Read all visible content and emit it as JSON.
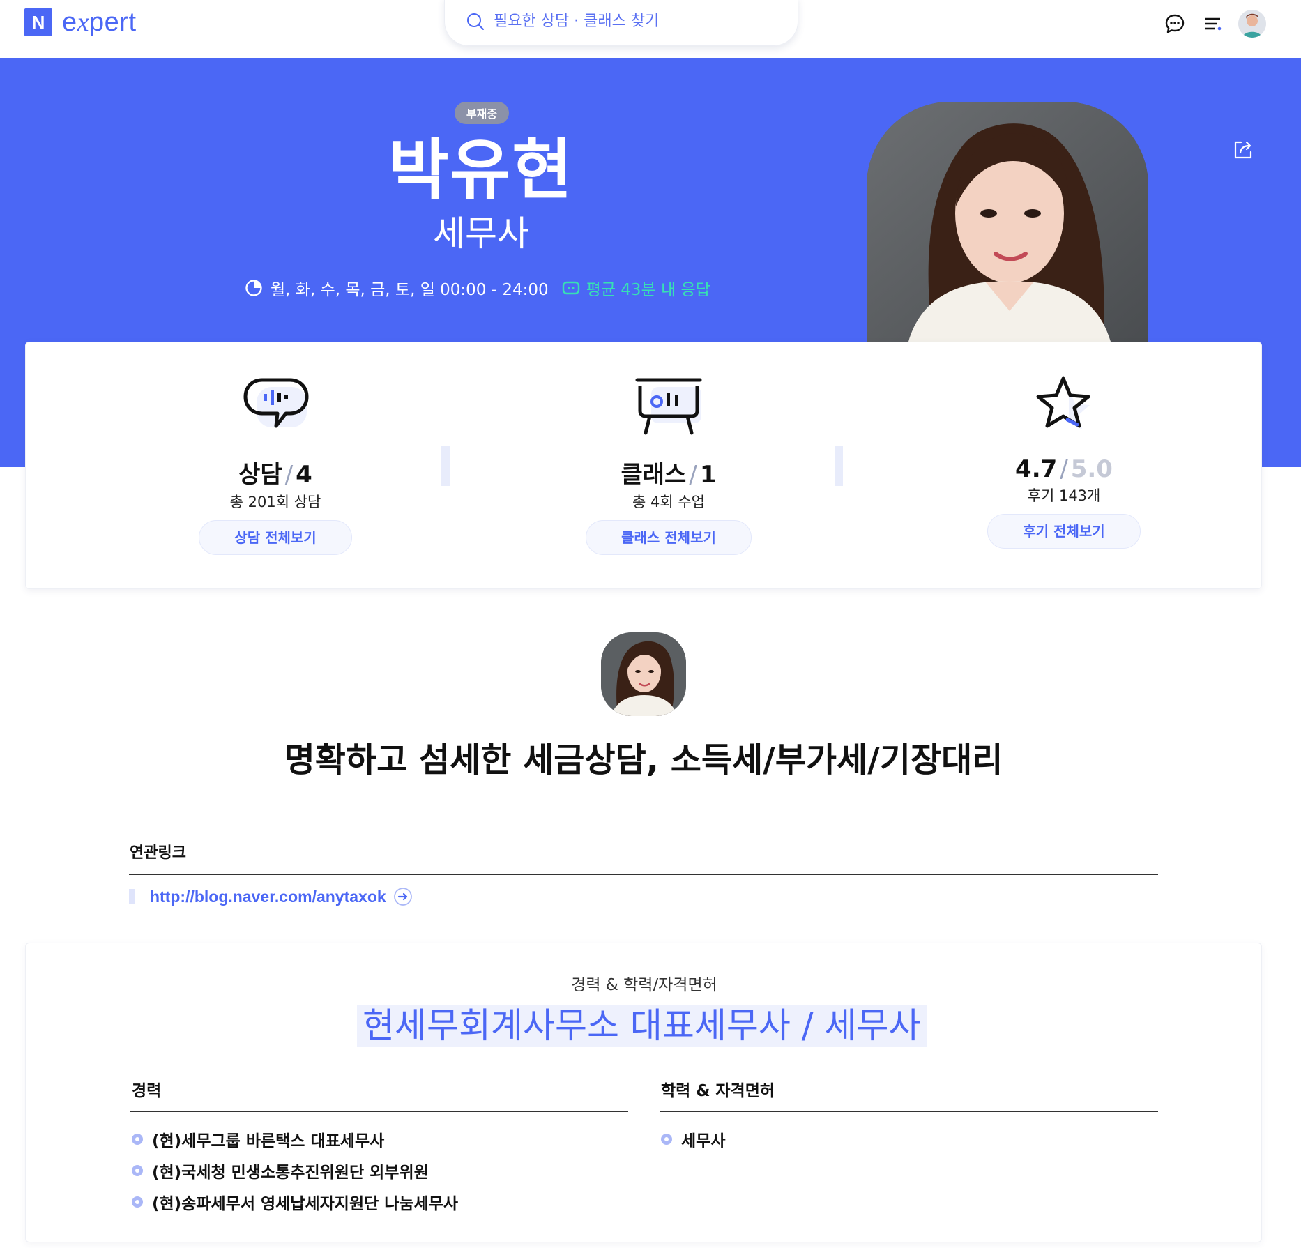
{
  "topbar": {
    "logo_mark": "N",
    "logo_text": "expert",
    "search_placeholder": "필요한 상담 · 클래스 찾기",
    "icons": [
      "chat-icon",
      "menu-icon",
      "user-avatar"
    ]
  },
  "hero": {
    "status_badge": "부재중",
    "name": "박유현",
    "profession": "세무사",
    "hours": "월, 화, 수, 목, 금, 토, 일 00:00 - 24:00",
    "response": "평균 43분 내 응답",
    "response_color": "#37e0b4",
    "background_color": "#4b67f5"
  },
  "stats": {
    "consult": {
      "label": "상담",
      "count": "4",
      "sub": "총 201회 상담",
      "button": "상담 전체보기"
    },
    "class": {
      "label": "클래스",
      "count": "1",
      "sub": "총 4회 수업",
      "button": "클래스 전체보기"
    },
    "review": {
      "score": "4.7",
      "max": "5.0",
      "sub": "후기 143개",
      "button": "후기 전체보기"
    }
  },
  "headline": "명확하고 섬세한 세금상담, 소득세/부가세/기장대리",
  "links": {
    "title": "연관링크",
    "items": [
      "http://blog.naver.com/anytaxok"
    ]
  },
  "career": {
    "subtitle": "경력 & 학력/자격면허",
    "main": "현세무회계사무소 대표세무사 / 세무사",
    "experience_title": "경력",
    "experience": [
      "(현)세무그룹 바른택스 대표세무사",
      "(현)국세청 민생소통추진위원단 외부위원",
      "(현)송파세무서 영세납세자지원단 나눔세무사"
    ],
    "education_title": "학력 & 자격면허",
    "education": [
      "세무사"
    ]
  }
}
